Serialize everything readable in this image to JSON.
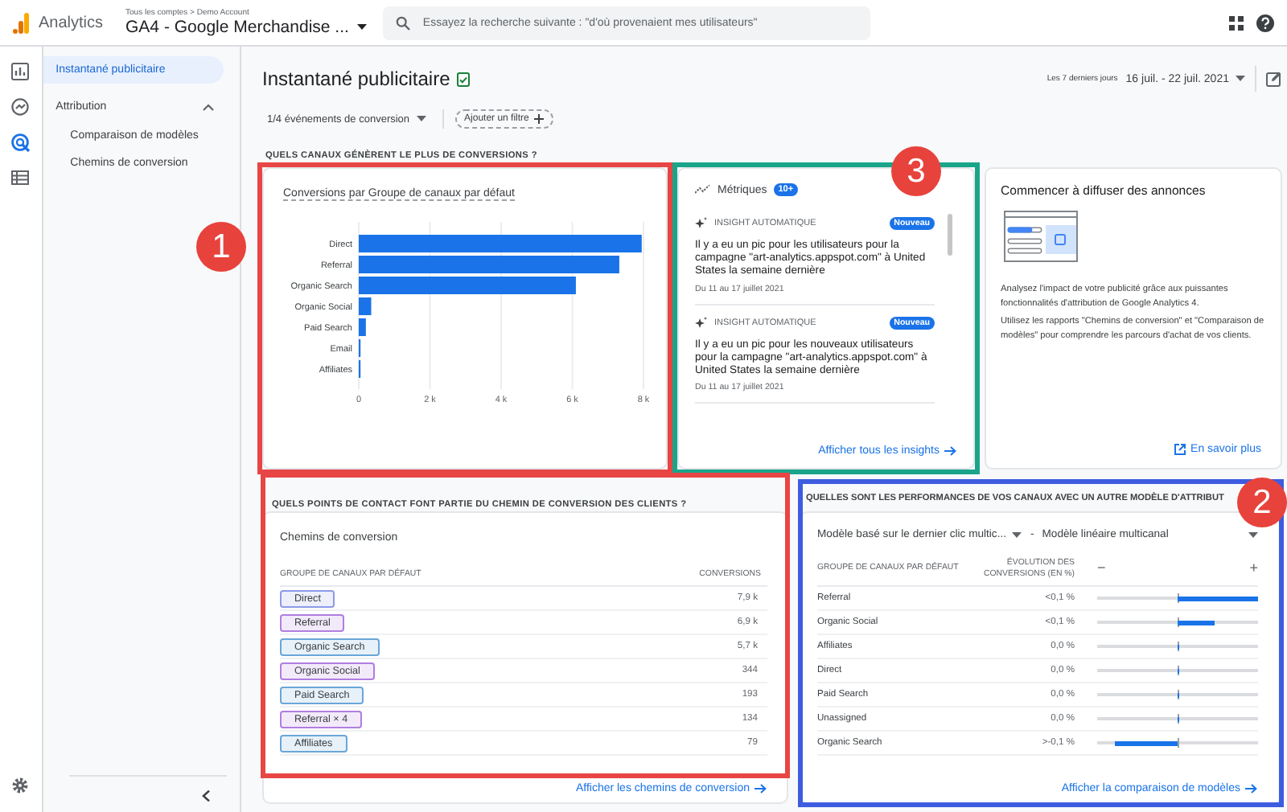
{
  "top_bar": {
    "product": "Analytics",
    "breadcrumb": "Tous les comptes > Demo Account",
    "property": "GA4 - Google Merchandise ...",
    "search": {
      "placeholder": "Essayez la recherche suivante : \"d'où provenaient mes utilisateurs\""
    }
  },
  "rail_items": [
    {
      "kind": "reports",
      "selected": false
    },
    {
      "kind": "explore",
      "selected": false
    },
    {
      "kind": "advertising",
      "selected": true
    },
    {
      "kind": "configure",
      "selected": false
    }
  ],
  "nav": {
    "items": [
      {
        "label": "Instantané publicitaire",
        "selected": true
      },
      {
        "label": "Attribution",
        "selected": false,
        "expanded": true,
        "children": [
          {
            "label": "Comparaison de modèles",
            "selected": false
          },
          {
            "label": "Chemins de conversion",
            "selected": false
          }
        ]
      }
    ]
  },
  "header": {
    "title": "Instantané publicitaire",
    "date_caption": "Les 7 derniers jours",
    "date_range": "16 juil. - 22 juil. 2021",
    "conversion_filter": "1/4 événements de conversion",
    "add_filter": "Ajouter un filtre"
  },
  "channels_section": {
    "heading": "QUELS CANAUX GÉNÈRENT LE PLUS DE CONVERSIONS ?",
    "annotation": {
      "number": "1",
      "color": "#e84545"
    },
    "chart_data": {
      "type": "bar",
      "orientation": "horizontal",
      "grid": true,
      "title": "Conversions par Groupe de canaux par défaut",
      "categories": [
        "Direct",
        "Referral",
        "Organic Search",
        "Organic Social",
        "Paid Search",
        "Email",
        "Affiliates"
      ],
      "values": [
        7950,
        7320,
        6100,
        350,
        200,
        50,
        50
      ],
      "xlim": [
        0,
        8000
      ],
      "xticks": [
        {
          "value": 0,
          "label": "0"
        },
        {
          "value": 2000,
          "label": "2 k"
        },
        {
          "value": 4000,
          "label": "4 k"
        },
        {
          "value": 6000,
          "label": "6 k"
        },
        {
          "value": 8000,
          "label": "8 k"
        }
      ]
    }
  },
  "insights": {
    "title": "Métriques",
    "count": "10+",
    "annotation": {
      "number": "3",
      "color": "#1aa58a"
    },
    "items": [
      {
        "kind_label": "INSIGHT AUTOMATIQUE",
        "badge": "Nouveau",
        "text": "Il y a eu un pic pour les utilisateurs pour la campagne \"art-analytics.appspot.com\" à United States la semaine dernière",
        "date": "Du 11 au 17 juillet 2021"
      },
      {
        "kind_label": "INSIGHT AUTOMATIQUE",
        "badge": "Nouveau",
        "text": "Il y a eu un pic pour les nouveaux utilisateurs pour la campagne \"art-analytics.appspot.com\" à United States la semaine dernière",
        "date": "Du 11 au 17 juillet 2021"
      }
    ],
    "link": "Afficher tous les insights"
  },
  "ads": {
    "title": "Commencer à diffuser des annonces",
    "paragraphs": [
      "Analysez l'impact de votre publicité grâce aux puissantes fonctionnalités d'attribution de Google Analytics 4.",
      "Utilisez les rapports \"Chemins de conversion\" et \"Comparaison de modèles\" pour comprendre les parcours d'achat de vos clients."
    ],
    "link": "En savoir plus"
  },
  "paths_section": {
    "heading": "QUELS POINTS DE CONTACT FONT PARTIE DU CHEMIN DE CONVERSION DES CLIENTS ?",
    "annotation": {
      "color": "#e84545"
    },
    "title": "Chemins de conversion",
    "columns": [
      "GROUPE DE CANAUX PAR DÉFAUT",
      "CONVERSIONS"
    ],
    "rows": [
      {
        "channel": "Direct",
        "color": "#8c9ae8",
        "conversions": "7,9 k"
      },
      {
        "channel": "Referral",
        "color": "#b07ee0",
        "conversions": "6,9 k"
      },
      {
        "channel": "Organic Search",
        "color": "#6aa6d8",
        "conversions": "5,7 k"
      },
      {
        "channel": "Organic Social",
        "color": "#b07ee0",
        "conversions": "344"
      },
      {
        "channel": "Paid Search",
        "color": "#6aa6d8",
        "conversions": "193"
      },
      {
        "channel": "Referral × 4",
        "color": "#b07ee0",
        "conversions": "134"
      },
      {
        "channel": "Affiliates",
        "color": "#6aa6d8",
        "conversions": "79"
      }
    ],
    "link": "Afficher les chemins de conversion"
  },
  "performance_section": {
    "heading": "QUELLES SONT LES PERFORMANCES DE VOS CANAUX AVEC UN AUTRE MODÈLE D'ATTRIBUT",
    "annotation": {
      "number": "2",
      "color": "#3d5ce0"
    },
    "model_a": "Modèle basé sur le dernier clic multic...",
    "separator": "-",
    "model_b": "Modèle linéaire multicanal",
    "columns": [
      "GROUPE DE CANAUX PAR DÉFAUT",
      "ÉVOLUTION DES CONVERSIONS (EN %)"
    ],
    "scale_minus": "−",
    "scale_plus": "+",
    "rows": [
      {
        "channel": "Referral",
        "change": "<0,1 %",
        "negative": false,
        "level": 1.0
      },
      {
        "channel": "Organic Social",
        "change": "<0,1 %",
        "negative": false,
        "level": 0.46
      },
      {
        "channel": "Affiliates",
        "change": "0,0 %",
        "negative": false,
        "level": 0
      },
      {
        "channel": "Direct",
        "change": "0,0 %",
        "negative": false,
        "level": 0
      },
      {
        "channel": "Paid Search",
        "change": "0,0 %",
        "negative": false,
        "level": 0
      },
      {
        "channel": "Unassigned",
        "change": "0,0 %",
        "negative": false,
        "level": 0
      },
      {
        "channel": "Organic Search",
        "change": ">-0,1 %",
        "negative": true,
        "level": 0.78
      }
    ],
    "link": "Afficher la comparaison de modèles"
  }
}
